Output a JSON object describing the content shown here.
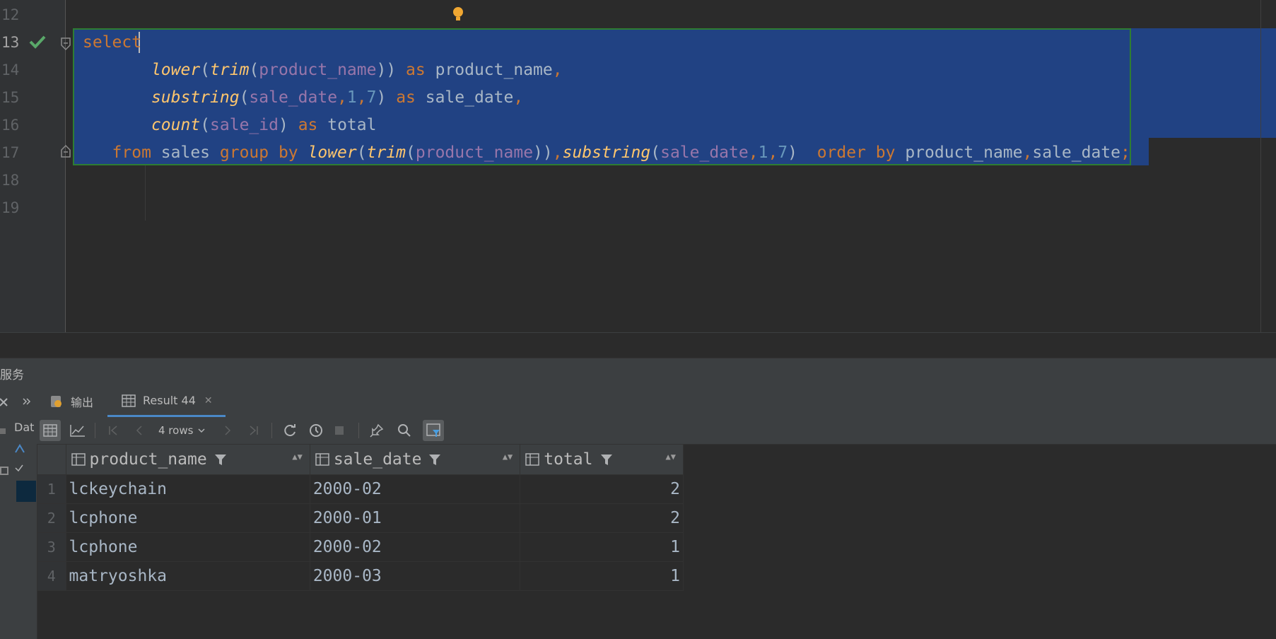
{
  "editor": {
    "line_numbers": [
      "12",
      "13",
      "14",
      "15",
      "16",
      "17",
      "18",
      "19"
    ],
    "active_line": "13",
    "code": [
      [
        {
          "t": "select",
          "c": "kw"
        }
      ],
      [
        {
          "t": "       "
        },
        {
          "t": "lower",
          "c": "fn"
        },
        {
          "t": "(",
          "c": "pl"
        },
        {
          "t": "trim",
          "c": "fn"
        },
        {
          "t": "(",
          "c": "pl"
        },
        {
          "t": "product_name",
          "c": "col"
        },
        {
          "t": ")) ",
          "c": "pl"
        },
        {
          "t": "as",
          "c": "kw"
        },
        {
          "t": " product_name",
          "c": "pl"
        },
        {
          "t": ",",
          "c": "kw"
        }
      ],
      [
        {
          "t": "       "
        },
        {
          "t": "substring",
          "c": "fn"
        },
        {
          "t": "(",
          "c": "pl"
        },
        {
          "t": "sale_date",
          "c": "col"
        },
        {
          "t": ",",
          "c": "kw"
        },
        {
          "t": "1",
          "c": "num"
        },
        {
          "t": ",",
          "c": "kw"
        },
        {
          "t": "7",
          "c": "num"
        },
        {
          "t": ") ",
          "c": "pl"
        },
        {
          "t": "as",
          "c": "kw"
        },
        {
          "t": " sale_date",
          "c": "pl"
        },
        {
          "t": ",",
          "c": "kw"
        }
      ],
      [
        {
          "t": "       "
        },
        {
          "t": "count",
          "c": "fn"
        },
        {
          "t": "(",
          "c": "pl"
        },
        {
          "t": "sale_id",
          "c": "col"
        },
        {
          "t": ") ",
          "c": "pl"
        },
        {
          "t": "as",
          "c": "kw"
        },
        {
          "t": " total",
          "c": "pl"
        }
      ],
      [
        {
          "t": "   "
        },
        {
          "t": "from",
          "c": "kw"
        },
        {
          "t": " sales ",
          "c": "pl"
        },
        {
          "t": "group by",
          "c": "kw"
        },
        {
          "t": " ",
          "c": "pl"
        },
        {
          "t": "lower",
          "c": "fn"
        },
        {
          "t": "(",
          "c": "pl"
        },
        {
          "t": "trim",
          "c": "fn"
        },
        {
          "t": "(",
          "c": "pl"
        },
        {
          "t": "product_name",
          "c": "col"
        },
        {
          "t": "))",
          "c": "pl"
        },
        {
          "t": ",",
          "c": "kw"
        },
        {
          "t": "substring",
          "c": "fn"
        },
        {
          "t": "(",
          "c": "pl"
        },
        {
          "t": "sale_date",
          "c": "col"
        },
        {
          "t": ",",
          "c": "kw"
        },
        {
          "t": "1",
          "c": "num"
        },
        {
          "t": ",",
          "c": "kw"
        },
        {
          "t": "7",
          "c": "num"
        },
        {
          "t": ")  ",
          "c": "pl"
        },
        {
          "t": "order by",
          "c": "kw"
        },
        {
          "t": " product_name",
          "c": "pl"
        },
        {
          "t": ",",
          "c": "kw"
        },
        {
          "t": "sale_date",
          "c": "pl"
        },
        {
          "t": ";",
          "c": "kw"
        }
      ]
    ]
  },
  "services": {
    "title": "服务"
  },
  "tabs": [
    {
      "label": "输出",
      "icon": "output-icon"
    },
    {
      "label": "Result 44",
      "icon": "table-icon",
      "close": "✕"
    }
  ],
  "toolbar": {
    "rows_label": "4 rows"
  },
  "grid": {
    "columns": [
      "product_name",
      "sale_date",
      "total"
    ],
    "rows": [
      {
        "n": "1",
        "product_name": "lckeychain",
        "sale_date": "2000-02",
        "total": "2"
      },
      {
        "n": "2",
        "product_name": "lcphone",
        "sale_date": "2000-01",
        "total": "2"
      },
      {
        "n": "3",
        "product_name": "lcphone",
        "sale_date": "2000-02",
        "total": "1"
      },
      {
        "n": "4",
        "product_name": "matryoshka",
        "sale_date": "2000-03",
        "total": "1"
      }
    ]
  },
  "left_strip": {
    "label": "Dat"
  }
}
